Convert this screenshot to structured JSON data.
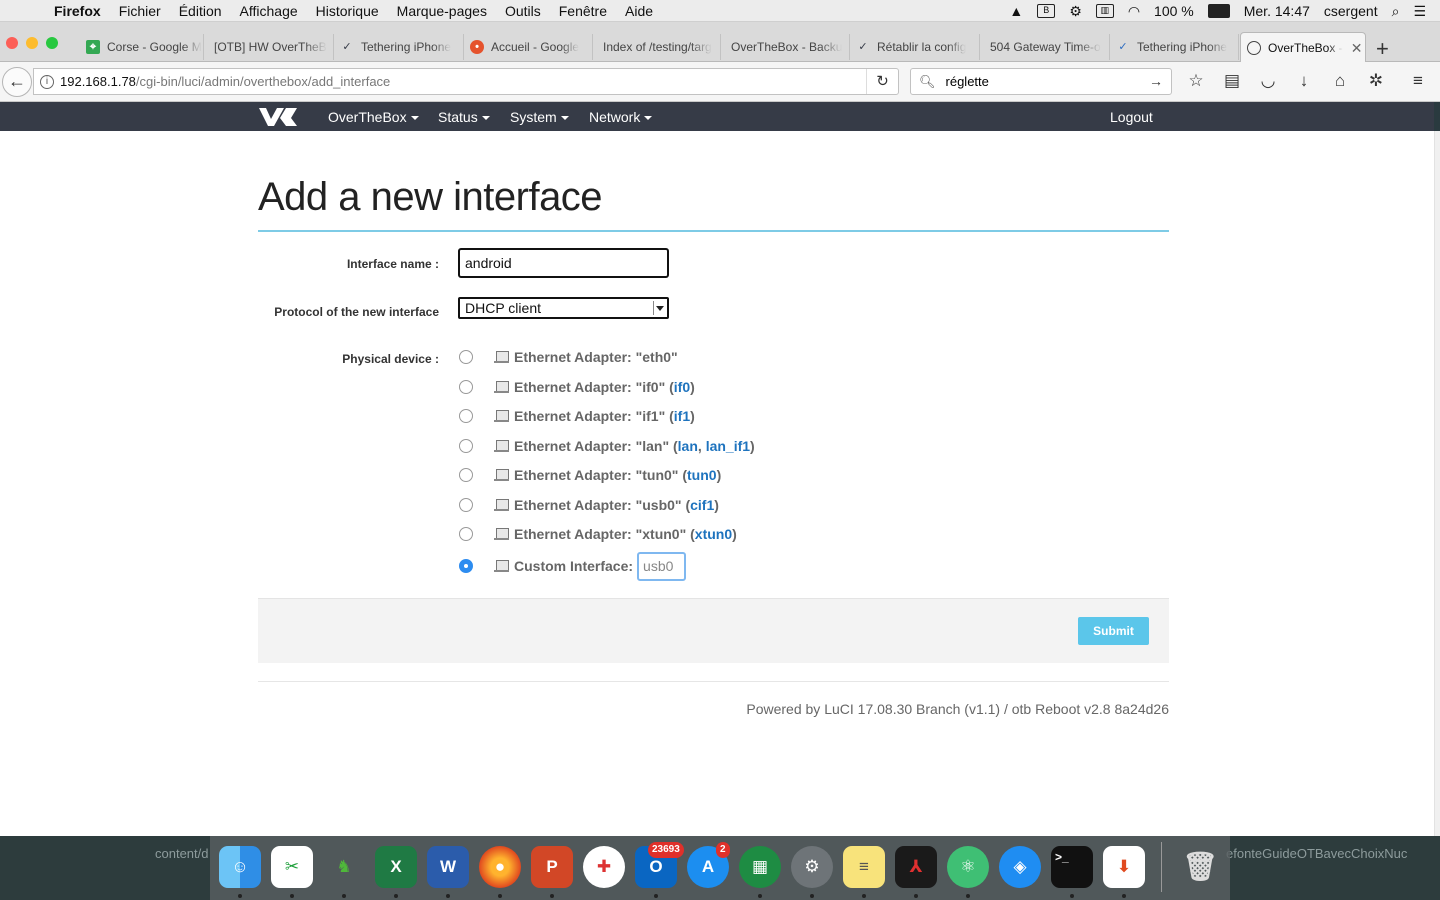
{
  "menubar": {
    "app": "Firefox",
    "items": [
      "Fichier",
      "Édition",
      "Affichage",
      "Historique",
      "Marque-pages",
      "Outils",
      "Fenêtre",
      "Aide"
    ],
    "battery": "100 %",
    "clock": "Mer. 14:47",
    "user": "csergent"
  },
  "tabs": [
    {
      "title": "Corse - Google M",
      "icon": "google-maps-icon"
    },
    {
      "title": "[OTB] HW OverTheB",
      "icon": "blank"
    },
    {
      "title": "Tethering iPhone",
      "icon": "overthebox-icon"
    },
    {
      "title": "Accueil - Google",
      "icon": "red-circle-icon"
    },
    {
      "title": "Index of /testing/targ",
      "icon": "blank"
    },
    {
      "title": "OverTheBox - Backu",
      "icon": "blank"
    },
    {
      "title": "Rétablir la config",
      "icon": "overthebox-icon"
    },
    {
      "title": "504 Gateway Time-o",
      "icon": "blank"
    },
    {
      "title": "Tethering iPhone",
      "icon": "overthebox-icon"
    },
    {
      "title": "OverTheBox -",
      "icon": "otb-globe-icon"
    }
  ],
  "url": {
    "host": "192.168.1.78",
    "path": "/cgi-bin/luci/admin/overthebox/add_interface"
  },
  "search": {
    "value": "réglette"
  },
  "nav": {
    "items": [
      "OverTheBox",
      "Status",
      "System",
      "Network"
    ],
    "logout": "Logout"
  },
  "page": {
    "title": "Add a new interface",
    "interface_name_label": "Interface name :",
    "interface_name_value": "android",
    "protocol_label": "Protocol of the new interface",
    "protocol_value": "DHCP client",
    "physical_device_label": "Physical device :",
    "devices": [
      {
        "prefix": "Ethernet Adapter: \"eth0\"",
        "networks": [],
        "selected": false
      },
      {
        "prefix": "Ethernet Adapter: \"if0\"",
        "networks": [
          "if0"
        ],
        "selected": false
      },
      {
        "prefix": "Ethernet Adapter: \"if1\"",
        "networks": [
          "if1"
        ],
        "selected": false
      },
      {
        "prefix": "Ethernet Adapter: \"lan\"",
        "networks": [
          "lan",
          "lan_if1"
        ],
        "selected": false
      },
      {
        "prefix": "Ethernet Adapter: \"tun0\"",
        "networks": [
          "tun0"
        ],
        "selected": false
      },
      {
        "prefix": "Ethernet Adapter: \"usb0\"",
        "networks": [
          "cif1"
        ],
        "selected": false
      },
      {
        "prefix": "Ethernet Adapter: \"xtun0\"",
        "networks": [
          "xtun0"
        ],
        "selected": false
      }
    ],
    "custom_label": "Custom Interface:",
    "custom_placeholder": "usb0",
    "custom_selected": true,
    "submit": "Submit",
    "footer": "Powered by LuCI 17.08.30 Branch (v1.1) / otb Reboot v2.8 8a24d26"
  },
  "dock": {
    "ghost_left": "content/d",
    "ghost_right": "efonteGuideOTBavecChoixNuc",
    "outlook_badge": "23693",
    "appstore_badge": "2"
  },
  "colors": {
    "luci_header": "#363b47",
    "accent_rule": "#7ecbe6",
    "submit": "#5bc6ea",
    "link": "#1e73be"
  }
}
